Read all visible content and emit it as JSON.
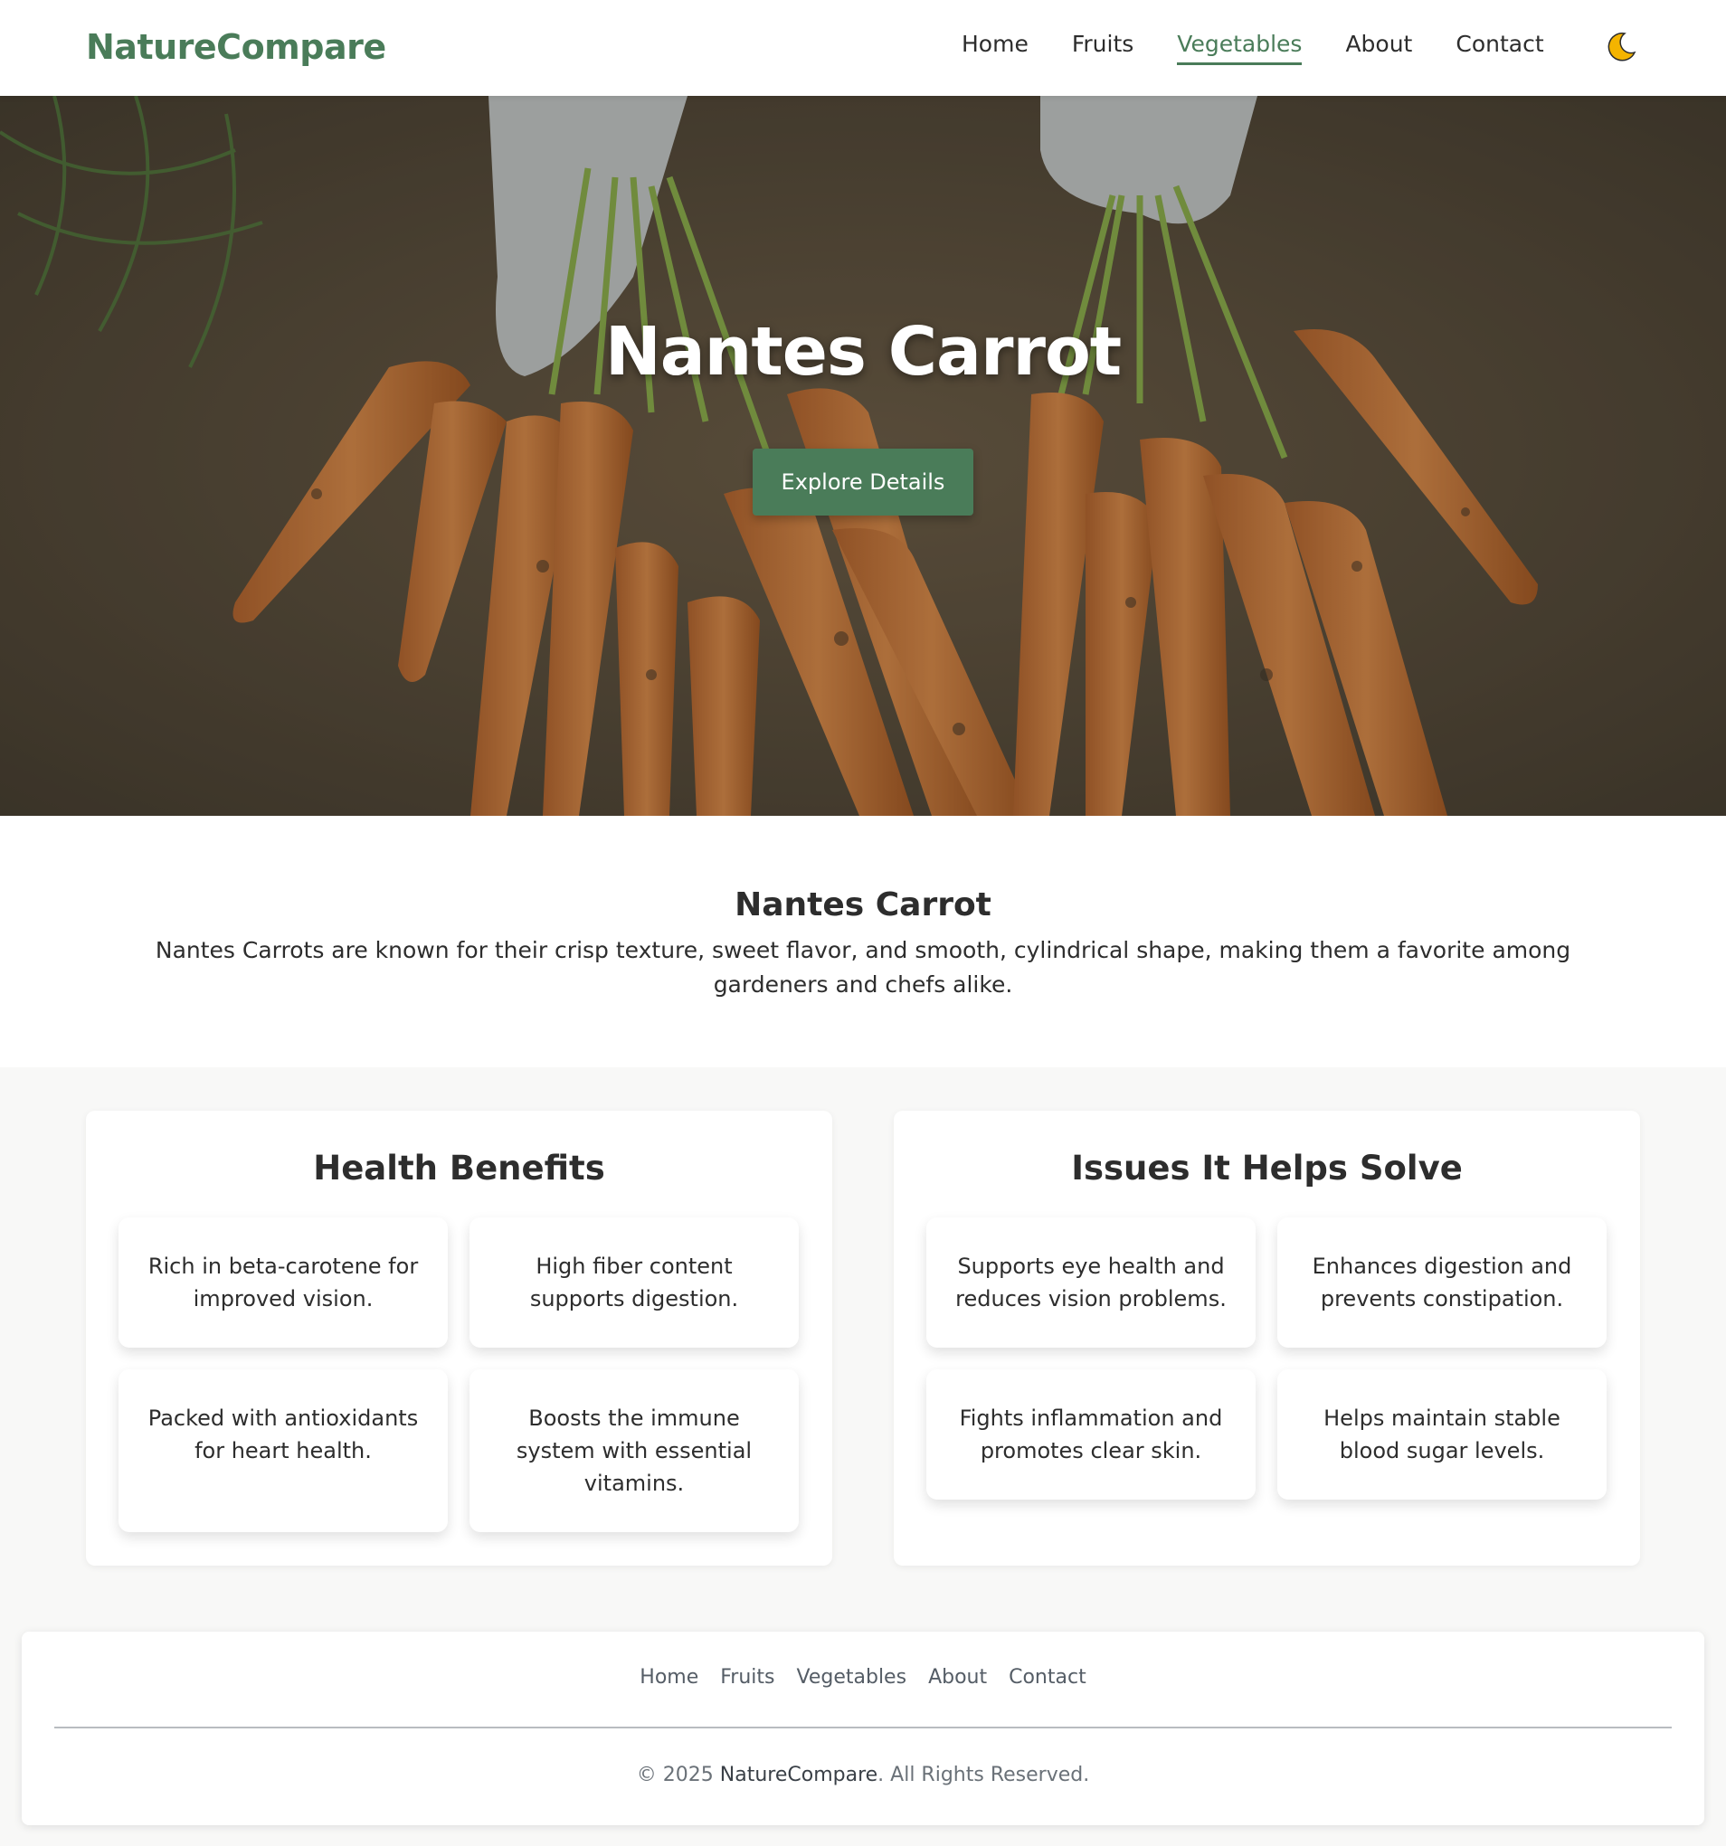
{
  "brand": {
    "logo_text": "NatureCompare",
    "accent_color": "#4a7c59"
  },
  "header": {
    "nav": [
      {
        "label": "Home",
        "active": false
      },
      {
        "label": "Fruits",
        "active": false
      },
      {
        "label": "Vegetables",
        "active": true
      },
      {
        "label": "About",
        "active": false
      },
      {
        "label": "Contact",
        "active": false
      }
    ],
    "theme_toggle_icon": "moon-icon"
  },
  "hero": {
    "title": "Nantes Carrot",
    "button_label": "Explore Details",
    "image_subject": "carrots-harvest-photo"
  },
  "intro": {
    "title": "Nantes Carrot",
    "text": "Nantes Carrots are known for their crisp texture, sweet flavor, and smooth, cylindrical shape, making them a favorite among gardeners and chefs alike."
  },
  "health_benefits": {
    "title": "Health Benefits",
    "items": [
      "Rich in beta-carotene for improved vision.",
      "High fiber content supports digestion.",
      "Packed with antioxidants for heart health.",
      "Boosts the immune system with essential vitamins."
    ]
  },
  "issues": {
    "title": "Issues It Helps Solve",
    "items": [
      "Supports eye health and reduces vision problems.",
      "Enhances digestion and prevents constipation.",
      "Fights inflammation and promotes clear skin.",
      "Helps maintain stable blood sugar levels."
    ]
  },
  "footer": {
    "nav": [
      "Home",
      "Fruits",
      "Vegetables",
      "About",
      "Contact"
    ],
    "copyright_prefix": "© 2025 ",
    "copyright_brand": "NatureCompare",
    "copyright_suffix": ". All Rights Reserved."
  }
}
